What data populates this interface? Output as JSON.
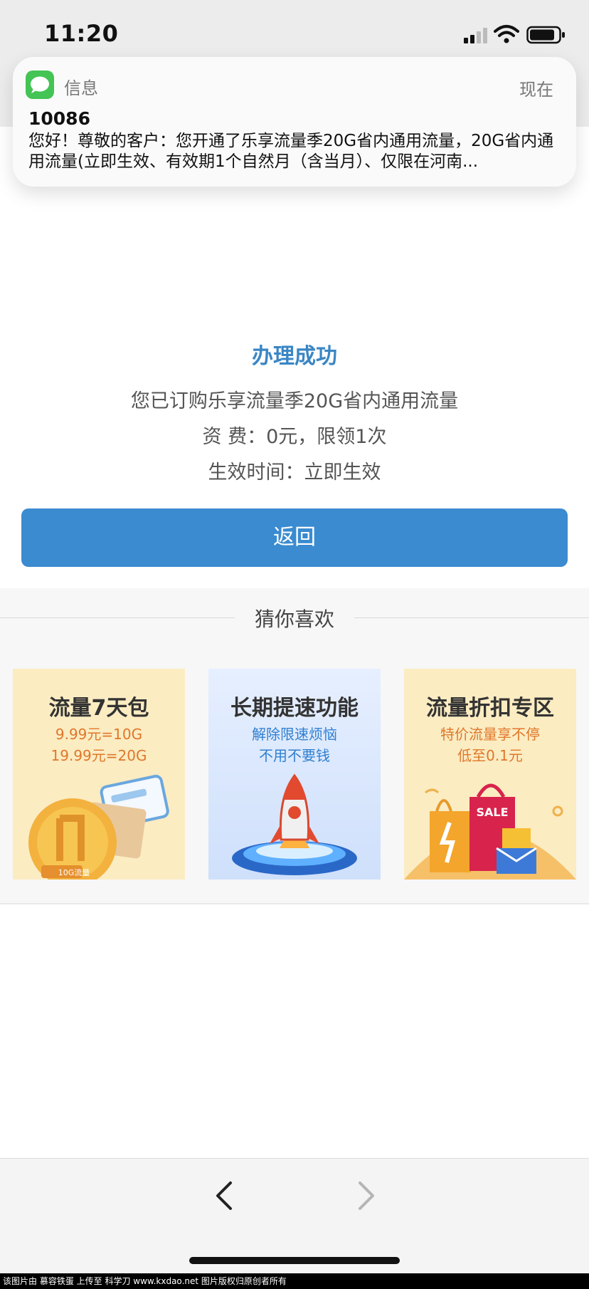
{
  "status_bar": {
    "time": "11:20"
  },
  "notification": {
    "app_name": "信息",
    "time": "现在",
    "sender": "10086",
    "body": "您好！尊敬的客户：您开通了乐享流量季20G省内通用流量，20G省内通用流量(立即生效、有效期1个自然月（含当月）、仅限在河南..."
  },
  "result": {
    "title": "办理成功",
    "line1": "您已订购乐享流量季20G省内通用流量",
    "line2": "资 费：0元，限领1次",
    "line3": "生效时间：立即生效",
    "back_button": "返回"
  },
  "recommend": {
    "title": "猜你喜欢",
    "cards": [
      {
        "title": "流量7天包",
        "sub1": "9.99元=10G",
        "sub2": "19.99元=20G",
        "coin_label": "10G流量"
      },
      {
        "title": "长期提速功能",
        "sub1": "解除限速烦恼",
        "sub2": "不用不要钱"
      },
      {
        "title": "流量折扣专区",
        "sub1": "特价流量享不停",
        "sub2": "低至0.1元",
        "bag_label": "SALE"
      }
    ]
  },
  "footer": {
    "text": "该图片由 慕容铁蛋 上传至 科学刀 www.kxdao.net 图片版权归原创者所有"
  },
  "colors": {
    "accent": "#3a8bd0",
    "title_blue": "#3a86c4",
    "card_orange": "#e0772a",
    "card_blue": "#2f7fd0",
    "message_green": "#43c454"
  }
}
